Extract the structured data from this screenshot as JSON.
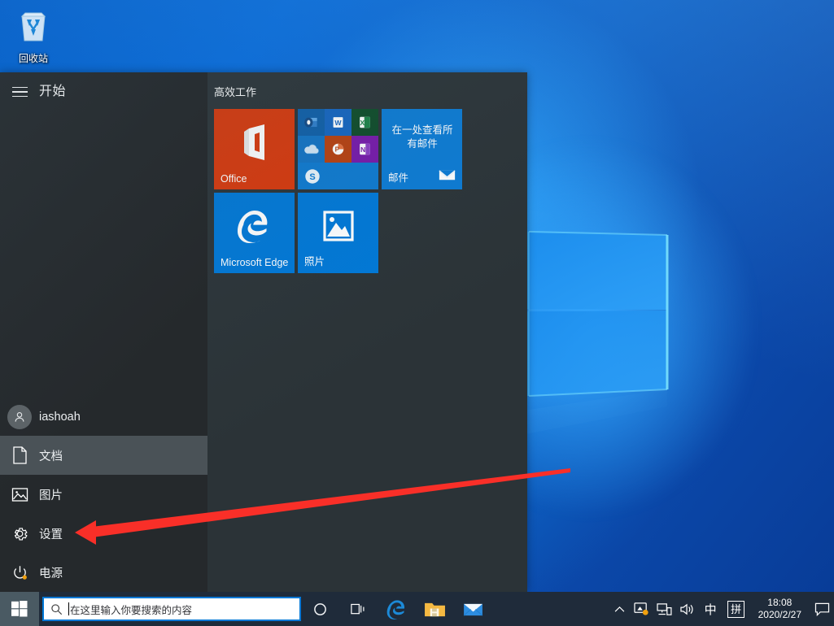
{
  "desktop": {
    "recycle_bin": {
      "label": "回收站",
      "icon": "recycle-bin-icon"
    },
    "wallpaper": {
      "name": "windows-10-hero-wallpaper",
      "base_color": "#0b63c9",
      "glow_color": "#35a8ff"
    }
  },
  "start_menu": {
    "hamburger_icon": "hamburger-menu-icon",
    "title": "开始",
    "nav": [
      {
        "key": "user",
        "label": "iashoah",
        "icon": "user-avatar-icon",
        "selected": false
      },
      {
        "key": "documents",
        "label": "文档",
        "icon": "document-icon",
        "selected": true
      },
      {
        "key": "pictures",
        "label": "图片",
        "icon": "picture-icon",
        "selected": false
      },
      {
        "key": "settings",
        "label": "设置",
        "icon": "gear-icon",
        "selected": false
      },
      {
        "key": "power",
        "label": "电源",
        "icon": "power-icon",
        "selected": false
      }
    ],
    "tile_group": {
      "title": "高效工作",
      "tiles": [
        {
          "key": "office",
          "label": "Office",
          "color": "#d8380b",
          "icon": "office-logo-icon"
        },
        {
          "key": "launcher",
          "label": "",
          "color": "#0078d7",
          "icon": "office-apps-launcher-icon",
          "apps": [
            {
              "name": "Outlook",
              "icon": "outlook-icon",
              "color": "#0f5fa8",
              "glyph": "O"
            },
            {
              "name": "Word",
              "icon": "word-icon",
              "color": "#1565c0",
              "glyph": "W"
            },
            {
              "name": "Excel",
              "icon": "excel-icon",
              "color": "#0f4c29",
              "glyph": "X"
            },
            {
              "name": "OneDrive",
              "icon": "onedrive-icon",
              "color": "#1273c4",
              "glyph": ""
            },
            {
              "name": "PowerPoint",
              "icon": "powerpoint-icon",
              "color": "#b8400f",
              "glyph": "P"
            },
            {
              "name": "OneNote",
              "icon": "onenote-icon",
              "color": "#7719aa",
              "glyph": "N"
            },
            {
              "name": "Skype",
              "icon": "skype-icon",
              "color": "#0e7ad0",
              "glyph": "S"
            }
          ]
        },
        {
          "key": "mail",
          "label": "邮件",
          "color": "#0c7bd4",
          "headline": "在一处查看所有邮件",
          "icon": "mail-envelope-icon"
        },
        {
          "key": "edge",
          "label": "Microsoft Edge",
          "color": "#0078d7",
          "icon": "edge-logo-icon"
        },
        {
          "key": "photos",
          "label": "照片",
          "color": "#0078d7",
          "icon": "photos-icon"
        }
      ]
    }
  },
  "annotation": {
    "arrow_color": "#f92f28",
    "points_to": "设置"
  },
  "taskbar": {
    "start_button": {
      "label": "开始",
      "icon": "windows-logo-icon"
    },
    "search": {
      "placeholder": "在这里输入你要搜索的内容",
      "value": "",
      "icon": "search-icon"
    },
    "buttons": [
      {
        "key": "cortana",
        "label": "Cortana",
        "icon": "cortana-circle-icon"
      },
      {
        "key": "task-view",
        "label": "任务视图",
        "icon": "task-view-icon"
      },
      {
        "key": "edge",
        "label": "Microsoft Edge",
        "icon": "edge-logo-icon"
      },
      {
        "key": "explorer",
        "label": "文件资源管理器",
        "icon": "file-explorer-icon"
      },
      {
        "key": "mail",
        "label": "邮件",
        "icon": "mail-envelope-icon"
      }
    ],
    "tray": [
      {
        "key": "overflow",
        "label": "显示隐藏的图标",
        "icon": "chevron-up-icon"
      },
      {
        "key": "security",
        "label": "安全中心",
        "icon": "security-shield-icon"
      },
      {
        "key": "network",
        "label": "网络",
        "icon": "network-icon"
      },
      {
        "key": "volume",
        "label": "音量",
        "icon": "volume-icon"
      },
      {
        "key": "ime-mode",
        "label": "中",
        "icon": "ime-chinese-icon"
      },
      {
        "key": "ime-pin",
        "label": "拼",
        "icon": "ime-pinyin-icon"
      }
    ],
    "clock": {
      "time": "18:08",
      "date": "2020/2/27"
    },
    "notifications": {
      "label": "操作中心",
      "icon": "notification-icon"
    }
  }
}
